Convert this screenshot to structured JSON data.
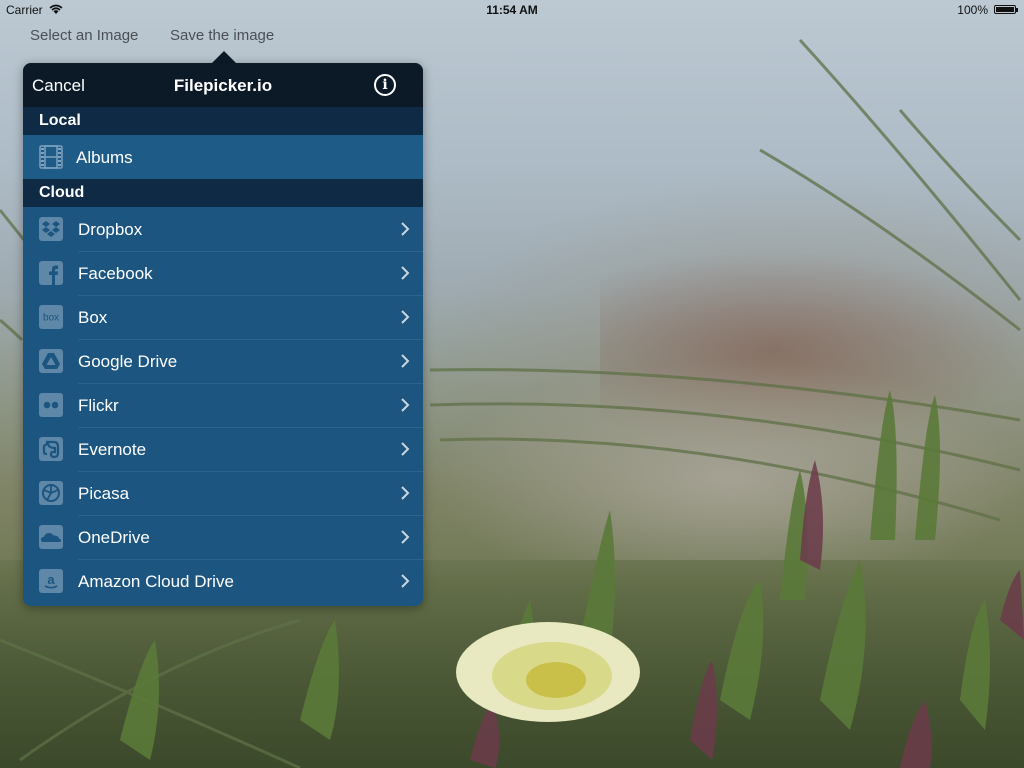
{
  "statusbar": {
    "carrier": "Carrier",
    "time": "11:54 AM",
    "battery": "100%"
  },
  "top_buttons": {
    "select_image": "Select an Image",
    "save_image": "Save the image"
  },
  "popover": {
    "cancel": "Cancel",
    "title": "Filepicker.io",
    "info_glyph": "i",
    "local_header": "Local",
    "local_items": [
      {
        "label": "Albums",
        "icon": "film-icon"
      }
    ],
    "cloud_header": "Cloud",
    "cloud_items": [
      {
        "label": "Dropbox",
        "icon": "dropbox-icon"
      },
      {
        "label": "Facebook",
        "icon": "facebook-icon"
      },
      {
        "label": "Box",
        "icon": "box-icon"
      },
      {
        "label": "Google Drive",
        "icon": "google-drive-icon"
      },
      {
        "label": "Flickr",
        "icon": "flickr-icon"
      },
      {
        "label": "Evernote",
        "icon": "evernote-icon"
      },
      {
        "label": "Picasa",
        "icon": "picasa-icon"
      },
      {
        "label": "OneDrive",
        "icon": "onedrive-icon"
      },
      {
        "label": "Amazon Cloud Drive",
        "icon": "amazon-icon"
      }
    ],
    "box_icon_text": "box",
    "amazon_icon_text": "a"
  },
  "colors": {
    "navbar": "#0c1a28",
    "section_header": "#0e2a45",
    "row": "#1c5580",
    "icon_tile": "#5e87a8"
  }
}
